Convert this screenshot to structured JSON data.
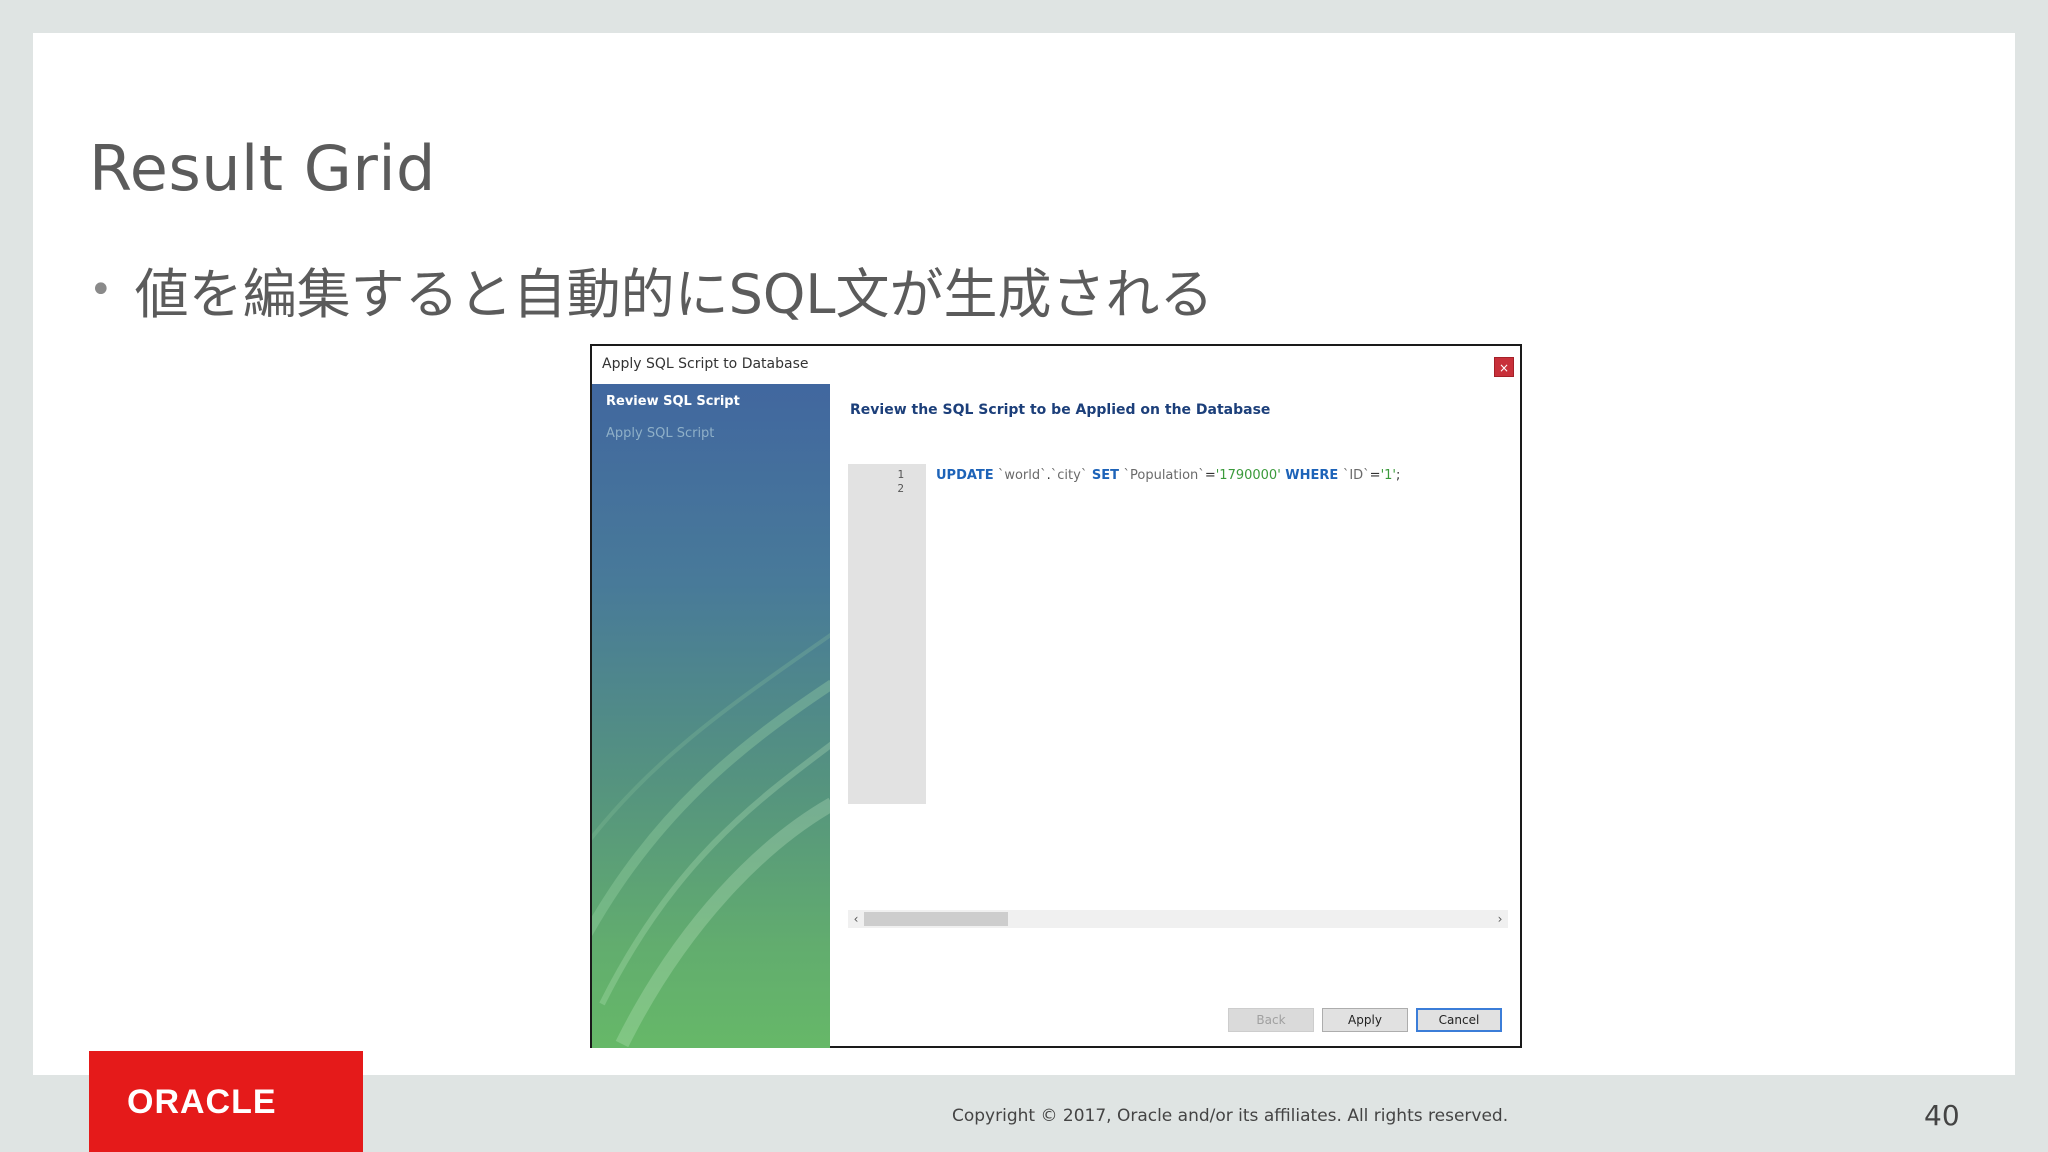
{
  "slide": {
    "title": "Result Grid",
    "bullet": "値を編集すると自動的にSQL文が生成される",
    "copyright": "Copyright © 2017, Oracle and/or its affiliates. All rights reserved.",
    "page_number": "40",
    "logo_text": "ORACLE"
  },
  "dialog": {
    "title": "Apply SQL Script to Database",
    "close_glyph": "×",
    "steps": [
      {
        "label": "Review SQL Script",
        "active": true
      },
      {
        "label": "Apply SQL Script",
        "active": false
      }
    ],
    "heading": "Review the SQL Script to be Applied on the Database",
    "editor": {
      "line_numbers": [
        "1",
        "2"
      ],
      "code": {
        "kw_update": "UPDATE",
        "ident_world": " `world`",
        "dot": ".",
        "ident_city": "`city`",
        "kw_set": " SET ",
        "ident_population": "`Population`",
        "eq1": "=",
        "str_value": "'1790000'",
        "kw_where": " WHERE ",
        "ident_id": "`ID`",
        "eq2": "=",
        "str_id": "'1'",
        "semicolon": ";"
      }
    },
    "scroll": {
      "left_glyph": "‹",
      "right_glyph": "›"
    },
    "buttons": {
      "back": "Back",
      "apply": "Apply",
      "cancel": "Cancel"
    }
  },
  "colors": {
    "oracle_red": "#e51a1a",
    "heading_blue": "#1c3f7a",
    "keyword_blue": "#1d63b8",
    "string_green": "#3a9a3a",
    "close_red": "#c8303a"
  }
}
